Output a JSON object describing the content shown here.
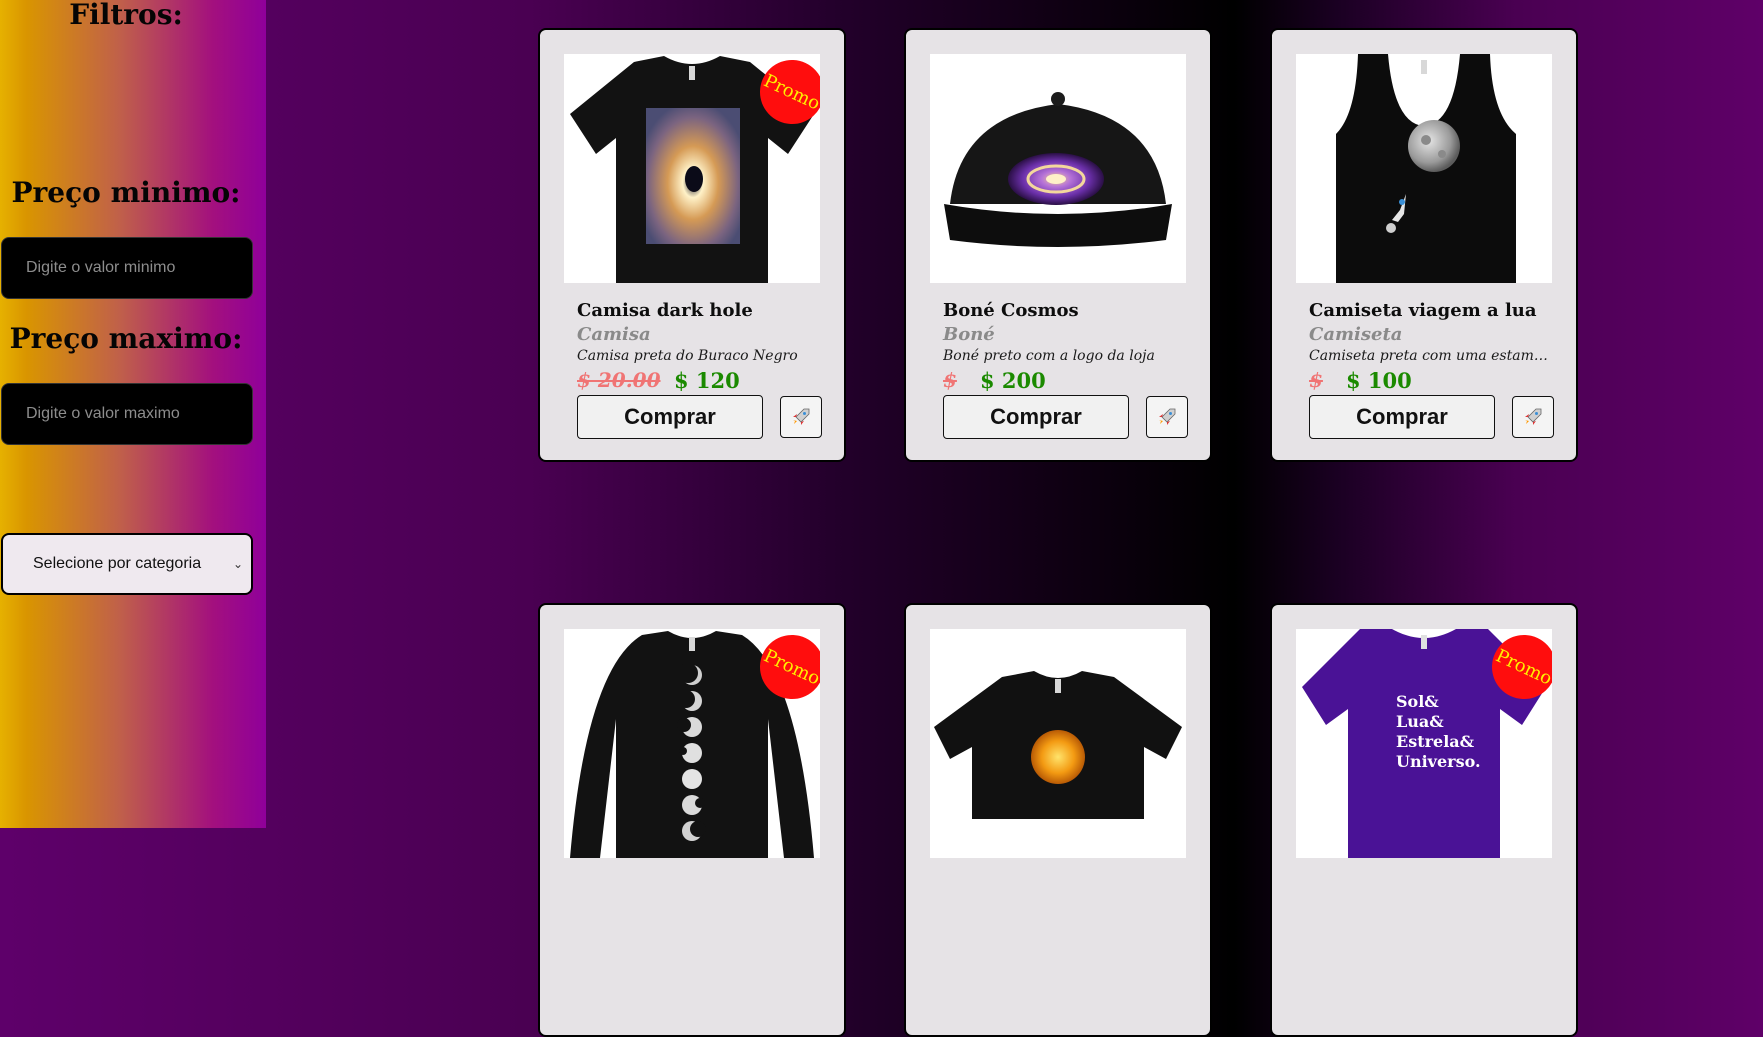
{
  "sidebar": {
    "title": "Filtros:",
    "min_label": "Preço minimo:",
    "min_placeholder": "Digite o valor minimo",
    "max_label": "Preço maximo:",
    "max_placeholder": "Digite o valor maximo",
    "category_select": "Selecione por categoria"
  },
  "promo_label": "Promo",
  "buy_label": "Comprar",
  "products": [
    {
      "name": "Camisa dark hole",
      "category": "Camisa",
      "description": "Camisa preta do Buraco Negro",
      "old_price": "$ 20.00",
      "price": "$ 120",
      "promo": true,
      "image_icon": "black-tshirt-blackhole-icon"
    },
    {
      "name": "Boné Cosmos",
      "category": "Boné",
      "description": "Boné preto com a logo da loja",
      "old_price": "$",
      "price": "$ 200",
      "promo": false,
      "image_icon": "black-cap-galaxy-icon"
    },
    {
      "name": "Camiseta viagem a lua",
      "category": "Camiseta",
      "description": "Camiseta preta com uma estampa...",
      "old_price": "$",
      "price": "$ 100",
      "promo": false,
      "image_icon": "black-tanktop-moon-icon"
    },
    {
      "name": "",
      "category": "",
      "description": "",
      "old_price": "",
      "price": "",
      "promo": true,
      "image_icon": "black-longsleeve-moonphases-icon"
    },
    {
      "name": "",
      "category": "",
      "description": "",
      "old_price": "",
      "price": "",
      "promo": false,
      "image_icon": "black-croptop-sun-icon"
    },
    {
      "name": "",
      "category": "",
      "description": "",
      "old_price": "",
      "price": "",
      "promo": true,
      "image_icon": "purple-tshirt-text-icon"
    }
  ],
  "shirt_print_text": [
    "Sol&",
    "Lua&",
    "Estrela&",
    "Universo."
  ],
  "colors": {
    "promo_bg": "#ff0d0d",
    "promo_text": "#ffee00",
    "price_new": "#1b8a00",
    "price_old": "#f07474"
  }
}
